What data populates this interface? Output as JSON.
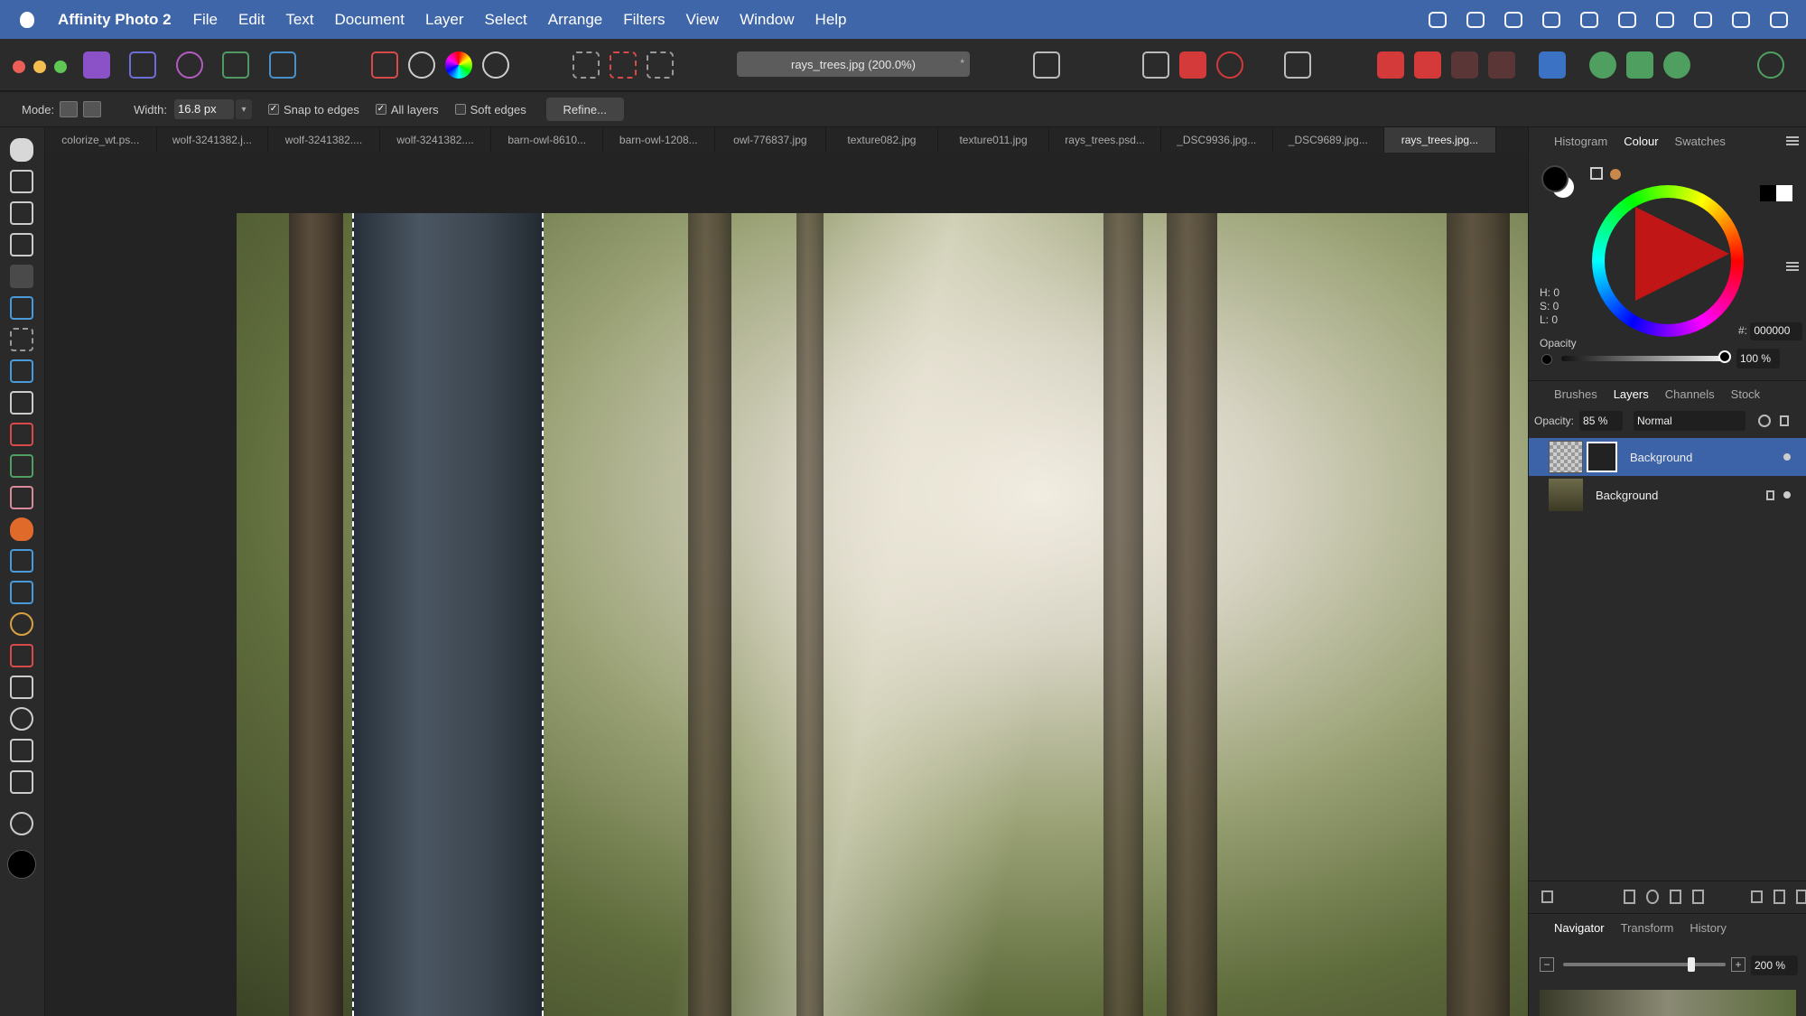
{
  "menubar": {
    "app_name": "Affinity Photo 2",
    "items": [
      "File",
      "Edit",
      "Text",
      "Document",
      "Layer",
      "Select",
      "Arrange",
      "Filters",
      "View",
      "Window",
      "Help"
    ]
  },
  "toolbar": {
    "document_title": "rays_trees.jpg (200.0%)",
    "close_tab_symbol": "*"
  },
  "context_toolbar": {
    "mode_label": "Mode:",
    "width_label": "Width:",
    "width_value": "16.8 px",
    "snap_to_edges": "Snap to edges",
    "all_layers": "All layers",
    "soft_edges": "Soft edges",
    "refine_button": "Refine..."
  },
  "document_tabs": [
    "colorize_wt.ps...",
    "wolf-3241382.j...",
    "wolf-3241382....",
    "wolf-3241382....",
    "barn-owl-8610...",
    "barn-owl-1208...",
    "owl-776837.jpg",
    "texture082.jpg",
    "texture011.jpg",
    "rays_trees.psd...",
    "_DSC9936.jpg...",
    "_DSC9689.jpg...",
    "rays_trees.jpg..."
  ],
  "colour_panel": {
    "tabs": [
      "Histogram",
      "Colour",
      "Swatches"
    ],
    "h": "H: 0",
    "s": "S: 0",
    "l": "L: 0",
    "hex_label": "#:",
    "hex_value": "000000",
    "opacity_label": "Opacity",
    "opacity_value": "100 %"
  },
  "layers_panel": {
    "tabs": [
      "Brushes",
      "Layers",
      "Channels",
      "Stock"
    ],
    "opacity_label": "Opacity:",
    "opacity_value": "85 %",
    "blend_mode": "Normal",
    "layers": [
      {
        "name": "Background"
      },
      {
        "name": "Background"
      }
    ]
  },
  "navigator_panel": {
    "tabs": [
      "Navigator",
      "Transform",
      "History"
    ],
    "zoom_value": "200 %"
  }
}
